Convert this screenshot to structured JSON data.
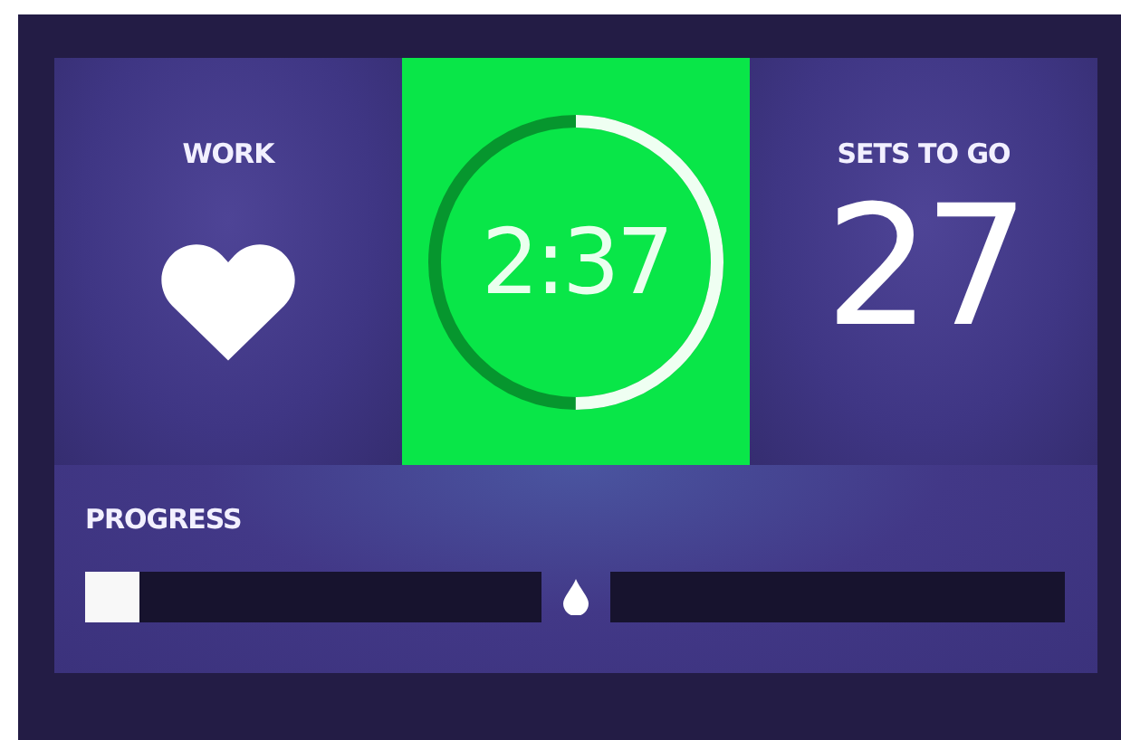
{
  "work": {
    "label": "WORK"
  },
  "timer": {
    "time": "2:37",
    "level": 0.5
  },
  "sets": {
    "label": "SETS TO GO",
    "value": "27"
  },
  "progress": {
    "label": "PROGRESS",
    "level": 0.06
  }
}
